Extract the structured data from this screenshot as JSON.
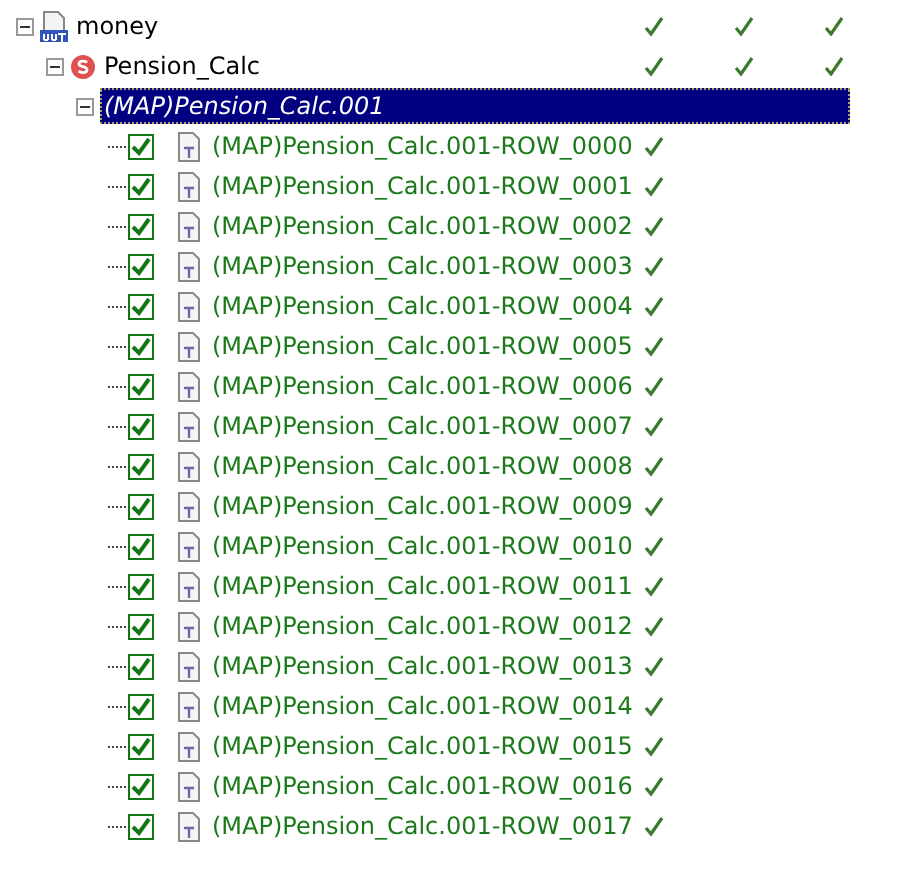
{
  "tree": [
    {
      "kind": "output",
      "label": "money",
      "expanded": true,
      "selected": false,
      "verified": [
        true,
        true,
        true
      ],
      "children": [
        {
          "kind": "script",
          "label": "Pension_Calc",
          "expanded": true,
          "selected": false,
          "verified": [
            true,
            true,
            true
          ],
          "children": [
            {
              "kind": "map",
              "label": "(MAP)Pension_Calc.001",
              "expanded": true,
              "selected": true,
              "verified": [
                false,
                false,
                false
              ],
              "children": [
                {
                  "kind": "row",
                  "label": "(MAP)Pension_Calc.001-ROW_0000",
                  "checked": true,
                  "selected": false,
                  "verified": [
                    true,
                    false,
                    false
                  ]
                },
                {
                  "kind": "row",
                  "label": "(MAP)Pension_Calc.001-ROW_0001",
                  "checked": true,
                  "selected": false,
                  "verified": [
                    true,
                    false,
                    false
                  ]
                },
                {
                  "kind": "row",
                  "label": "(MAP)Pension_Calc.001-ROW_0002",
                  "checked": true,
                  "selected": false,
                  "verified": [
                    true,
                    false,
                    false
                  ]
                },
                {
                  "kind": "row",
                  "label": "(MAP)Pension_Calc.001-ROW_0003",
                  "checked": true,
                  "selected": false,
                  "verified": [
                    true,
                    false,
                    false
                  ]
                },
                {
                  "kind": "row",
                  "label": "(MAP)Pension_Calc.001-ROW_0004",
                  "checked": true,
                  "selected": false,
                  "verified": [
                    true,
                    false,
                    false
                  ]
                },
                {
                  "kind": "row",
                  "label": "(MAP)Pension_Calc.001-ROW_0005",
                  "checked": true,
                  "selected": false,
                  "verified": [
                    true,
                    false,
                    false
                  ]
                },
                {
                  "kind": "row",
                  "label": "(MAP)Pension_Calc.001-ROW_0006",
                  "checked": true,
                  "selected": false,
                  "verified": [
                    true,
                    false,
                    false
                  ]
                },
                {
                  "kind": "row",
                  "label": "(MAP)Pension_Calc.001-ROW_0007",
                  "checked": true,
                  "selected": false,
                  "verified": [
                    true,
                    false,
                    false
                  ]
                },
                {
                  "kind": "row",
                  "label": "(MAP)Pension_Calc.001-ROW_0008",
                  "checked": true,
                  "selected": false,
                  "verified": [
                    true,
                    false,
                    false
                  ]
                },
                {
                  "kind": "row",
                  "label": "(MAP)Pension_Calc.001-ROW_0009",
                  "checked": true,
                  "selected": false,
                  "verified": [
                    true,
                    false,
                    false
                  ]
                },
                {
                  "kind": "row",
                  "label": "(MAP)Pension_Calc.001-ROW_0010",
                  "checked": true,
                  "selected": false,
                  "verified": [
                    true,
                    false,
                    false
                  ]
                },
                {
                  "kind": "row",
                  "label": "(MAP)Pension_Calc.001-ROW_0011",
                  "checked": true,
                  "selected": false,
                  "verified": [
                    true,
                    false,
                    false
                  ]
                },
                {
                  "kind": "row",
                  "label": "(MAP)Pension_Calc.001-ROW_0012",
                  "checked": true,
                  "selected": false,
                  "verified": [
                    true,
                    false,
                    false
                  ]
                },
                {
                  "kind": "row",
                  "label": "(MAP)Pension_Calc.001-ROW_0013",
                  "checked": true,
                  "selected": false,
                  "verified": [
                    true,
                    false,
                    false
                  ]
                },
                {
                  "kind": "row",
                  "label": "(MAP)Pension_Calc.001-ROW_0014",
                  "checked": true,
                  "selected": false,
                  "verified": [
                    true,
                    false,
                    false
                  ]
                },
                {
                  "kind": "row",
                  "label": "(MAP)Pension_Calc.001-ROW_0015",
                  "checked": true,
                  "selected": false,
                  "verified": [
                    true,
                    false,
                    false
                  ]
                },
                {
                  "kind": "row",
                  "label": "(MAP)Pension_Calc.001-ROW_0016",
                  "checked": true,
                  "selected": false,
                  "verified": [
                    true,
                    false,
                    false
                  ]
                },
                {
                  "kind": "row",
                  "label": "(MAP)Pension_Calc.001-ROW_0017",
                  "checked": true,
                  "selected": false,
                  "verified": [
                    true,
                    false,
                    false
                  ]
                }
              ]
            }
          ]
        }
      ]
    }
  ]
}
